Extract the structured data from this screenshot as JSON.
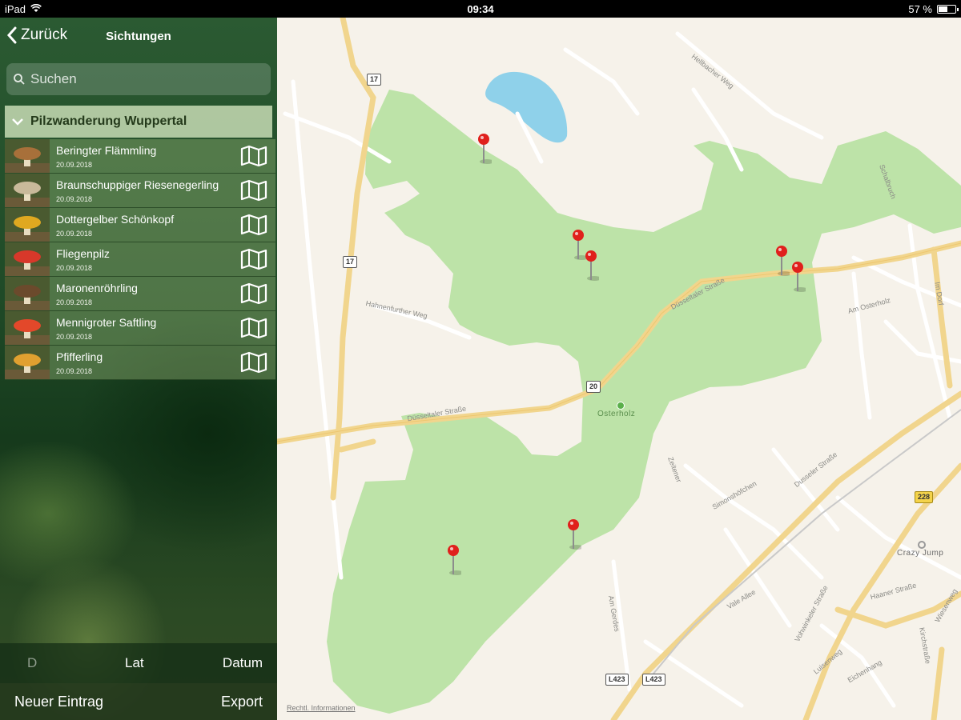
{
  "status_bar": {
    "device": "iPad",
    "time": "09:34",
    "battery": "57 %",
    "battery_level": 0.57
  },
  "nav": {
    "back_label": "Zurück",
    "title": "Sichtungen"
  },
  "search": {
    "placeholder": "Suchen"
  },
  "group": {
    "title": "Pilzwanderung Wuppertal"
  },
  "sightings": [
    {
      "name": "Beringter Flämmling",
      "date": "20.09.2018",
      "thumb_color": "#a8703a"
    },
    {
      "name": "Braunschuppiger Riesenegerling",
      "date": "20.09.2018",
      "thumb_color": "#c9b99a"
    },
    {
      "name": "Dottergelber Schönkopf",
      "date": "20.09.2018",
      "thumb_color": "#e0a820"
    },
    {
      "name": "Fliegenpilz",
      "date": "20.09.2018",
      "thumb_color": "#d8382a"
    },
    {
      "name": "Maronenröhrling",
      "date": "20.09.2018",
      "thumb_color": "#6b4a2c"
    },
    {
      "name": "Mennigroter Saftling",
      "date": "20.09.2018",
      "thumb_color": "#e3482a"
    },
    {
      "name": "Pfifferling",
      "date": "20.09.2018",
      "thumb_color": "#e0a030"
    }
  ],
  "sort_bar": {
    "first": "D",
    "second": "Lat",
    "third": "Datum"
  },
  "actions": {
    "new_entry": "Neuer Eintrag",
    "export": "Export"
  },
  "map": {
    "street_labels": {
      "dusseltaler_1": "Düsseltaler Straße",
      "dusseltaler_2": "Düsseltaler Straße",
      "harmeiershof": "Hahnenfurther Weg",
      "heilbacher": "Hellbacher Weg",
      "im_dorf": "Im Dorf",
      "schalbruch": "Schalbruch",
      "am_osterholz": "Am Osterholz",
      "simonshofchen": "Simonshöfchen",
      "zeitener": "Zeitener",
      "dusseler_str": "Dusseler Straße",
      "vohwinkeler": "Vohwinkeler Straße",
      "vale_allee": "Vale Allee",
      "haaner": "Haaner Straße",
      "wiesenweg": "Wiesenweg",
      "luisenweg": "Luisenweg",
      "eichenhang": "Eichenhang",
      "kirchstr": "Kirchstraße",
      "am_gerdes": "Am Gerdes"
    },
    "routes": {
      "b17_a": "17",
      "b17_b": "17",
      "b20": "20",
      "b228": "228",
      "l423_a": "L423",
      "l423_b": "L423"
    },
    "poi_osterholz": "Osterholz",
    "poi_crazy_jump": "Crazy Jump",
    "legal": "Rechtl. Informationen",
    "colors": {
      "forest": "#bde3a8",
      "water": "#8fd1ea",
      "road": "#f5dfa0",
      "land": "#f6f2ea",
      "pin": "#e0201c"
    }
  }
}
